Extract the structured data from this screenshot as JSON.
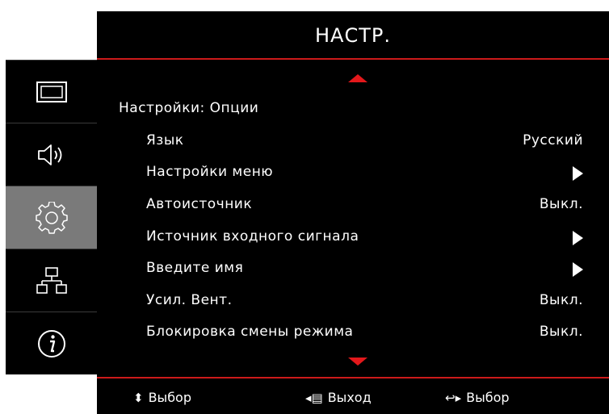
{
  "header": {
    "title": "НАСТР."
  },
  "sidebar": {
    "tabs": [
      {
        "name": "image",
        "icon": "image-frame-icon",
        "active": false
      },
      {
        "name": "audio",
        "icon": "speaker-icon",
        "active": false
      },
      {
        "name": "setup",
        "icon": "gear-icon",
        "active": true
      },
      {
        "name": "network",
        "icon": "network-icon",
        "active": false
      },
      {
        "name": "info",
        "icon": "info-icon",
        "active": false
      }
    ]
  },
  "menu": {
    "section_title": "Настройки: Опции",
    "items": [
      {
        "label": "Язык",
        "value": "Русский",
        "type": "value"
      },
      {
        "label": "Настройки меню",
        "value": "",
        "type": "submenu"
      },
      {
        "label": "Автоисточник",
        "value": "Выкл.",
        "type": "value"
      },
      {
        "label": "Источник входного сигнала",
        "value": "",
        "type": "submenu"
      },
      {
        "label": "Введите имя",
        "value": "",
        "type": "submenu"
      },
      {
        "label": "Усил. Вент.",
        "value": "Выкл.",
        "type": "value"
      },
      {
        "label": "Блокировка смены режима",
        "value": "Выкл.",
        "type": "value"
      }
    ]
  },
  "footer": {
    "hint_updown": {
      "glyph": "⬍",
      "label": "Выбор"
    },
    "hint_exit": {
      "glyph": "◂▤",
      "label": "Выход"
    },
    "hint_enter": {
      "glyph": "↩▸",
      "label": "Выбор"
    }
  },
  "colors": {
    "accent": "#e3181b",
    "background": "#000000",
    "active_tab": "#7a7a7a",
    "text": "#ffffff"
  }
}
